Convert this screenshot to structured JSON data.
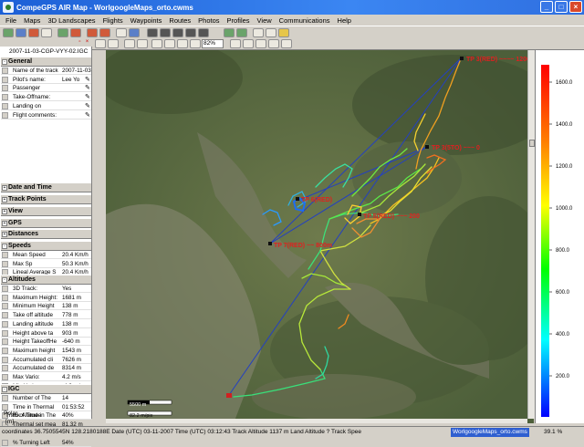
{
  "window": {
    "title": "CompeGPS AIR Map - WorlgoogleMaps_orto.cwms"
  },
  "menu": [
    "File",
    "Maps",
    "3D Landscapes",
    "Flights",
    "Waypoints",
    "Routes",
    "Photos",
    "Profiles",
    "View",
    "Communications",
    "Help"
  ],
  "toolbar": {
    "zoom_value": "82%"
  },
  "panel": {
    "filename": "2007-11-03-CGP-VYY-02.IGC",
    "sections": {
      "general": "General",
      "date_time": "Date and Time",
      "track_points": "Track Points",
      "view": "View",
      "gps": "GPS",
      "distances": "Distances",
      "speeds": "Speeds",
      "altitudes": "Altitudes",
      "igc": "IGC"
    },
    "general_rows": [
      {
        "k": "Name of the track",
        "v": "2007-11-03"
      },
      {
        "k": "Pilot's name:",
        "v": "Lee Yo"
      },
      {
        "k": "Passenger",
        "v": ""
      },
      {
        "k": "Take-Offname:",
        "v": ""
      },
      {
        "k": "Landing on",
        "v": ""
      },
      {
        "k": "Flight comments:",
        "v": ""
      }
    ],
    "speed_rows": [
      {
        "k": "Mean Speed",
        "v": "20.4 Km/h"
      },
      {
        "k": "Max Sp",
        "v": "50.3 Km/h"
      },
      {
        "k": "Lineal Average S",
        "v": "20.4 Km/h"
      }
    ],
    "altitude_rows": [
      {
        "k": "3D Track:",
        "v": "Yes"
      },
      {
        "k": "Maximum Height:",
        "v": "1681 m"
      },
      {
        "k": "Minimum Height",
        "v": "138 m"
      },
      {
        "k": "Take off altitude",
        "v": "778 m"
      },
      {
        "k": "Landing altitude",
        "v": "138 m"
      },
      {
        "k": "Height above ta",
        "v": "903 m"
      },
      {
        "k": "Height TakeoffHe",
        "v": "-640 m"
      },
      {
        "k": "Maximum height",
        "v": "1543 m"
      },
      {
        "k": "Accumulated cli",
        "v": "7626 m"
      },
      {
        "k": "Accumulated de",
        "v": "8314 m"
      },
      {
        "k": "Max Vario:",
        "v": "4.2 m/s"
      },
      {
        "k": "Min Vario:",
        "v": "-4.9 m/s"
      }
    ],
    "igc_rows": [
      {
        "k": "Number of The",
        "v": "14"
      },
      {
        "k": "Time in Thermal",
        "v": "01:53:52"
      },
      {
        "k": "% of Time in The",
        "v": "40%"
      },
      {
        "k": "Thermal set mea",
        "v": "81.32 m"
      },
      {
        "k": "% Turning Right",
        "v": "45%"
      },
      {
        "k": "% Turning Left",
        "v": "54%"
      }
    ],
    "polar": "Polar"
  },
  "map": {
    "scale_label": "5500 m",
    "speed_label": "82.2 m/pix",
    "waypoints": [
      {
        "label": "TP 3(RED) ~~~~ 1200"
      },
      {
        "label": "TP 3(5TO) ~~~ 0"
      },
      {
        "label": "TP 6(RED)"
      },
      {
        "label": "TP 5(RED) ~~~ 200"
      },
      {
        "label": "TP 7(RED) ~~ 800m"
      }
    ]
  },
  "legend": {
    "title": "Track Altitude",
    "unit": "[m]",
    "ticks": [
      "1600.0",
      "1400.0",
      "1200.0",
      "1000.0",
      "800.0",
      "600.0",
      "400.0",
      "200.0"
    ]
  },
  "statusbar": {
    "info": "coordinates 36.7505545N 128.2180188E  Date (UTC) 03-11-2007  Time (UTC) 03:12:43  Track Altitude 1137 m  Land Altitude ? Track Spee",
    "map_name": "WorlgoogleMaps_orto.cwms",
    "zoom": "39.1 %"
  }
}
